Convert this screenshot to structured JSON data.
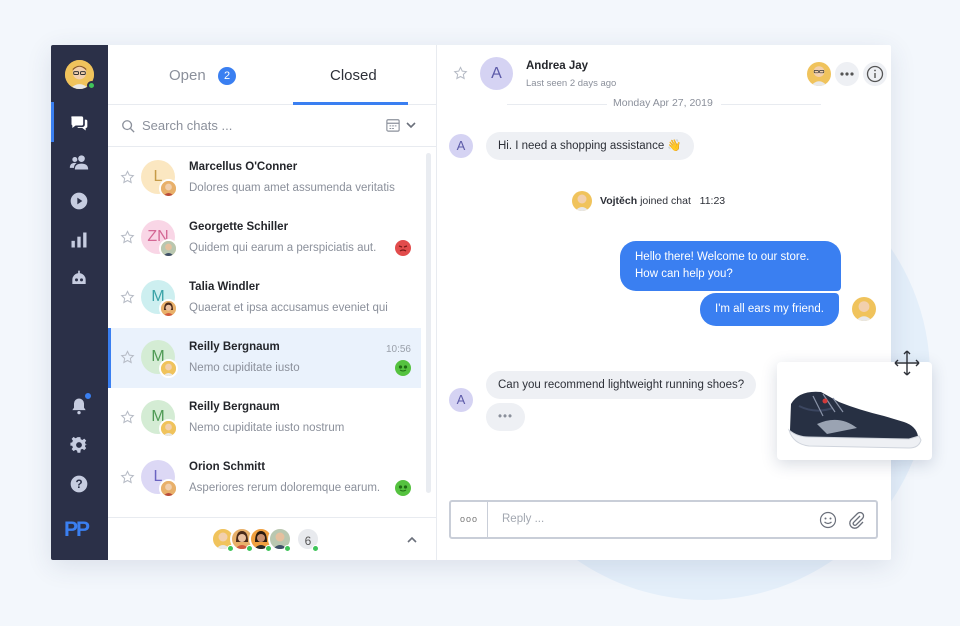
{
  "colors": {
    "accent": "#3a7ff1",
    "rail": "#2b3048",
    "online": "#3fc45a"
  },
  "sidebar": {
    "icons": [
      "chat-icon",
      "contacts-icon",
      "play-icon",
      "stats-icon",
      "bot-icon",
      "bell-icon",
      "gear-icon",
      "help-icon"
    ],
    "logo": "PP"
  },
  "tabs": {
    "open_label": "Open",
    "open_count": "2",
    "closed_label": "Closed"
  },
  "search": {
    "placeholder": "Search chats ..."
  },
  "chats": [
    {
      "name": "Marcellus O'Conner",
      "message": "Dolores quam amet assumenda veritatis",
      "initial": "L",
      "time": "",
      "status": ""
    },
    {
      "name": "Georgette Schiller",
      "message": "Quidem qui earum a perspiciatis aut.",
      "initial": "ZN",
      "time": "",
      "status": "angry"
    },
    {
      "name": "Talia Windler",
      "message": "Quaerat et ipsa accusamus eveniet qui",
      "initial": "M",
      "time": "",
      "status": ""
    },
    {
      "name": "Reilly Bergnaum",
      "message": "Nemo cupiditate iusto",
      "initial": "M",
      "time": "10:56",
      "status": "happy"
    },
    {
      "name": "Reilly Bergnaum",
      "message": "Nemo cupiditate iusto nostrum",
      "initial": "M",
      "time": "",
      "status": ""
    },
    {
      "name": "Orion Schmitt",
      "message": "Asperiores rerum doloremque earum.",
      "initial": "L",
      "time": "",
      "status": "happy"
    }
  ],
  "footer": {
    "more_agents": "6"
  },
  "conversation": {
    "title": "Andrea Jay",
    "subtitle": "Last seen 2 days ago",
    "avatar_initial": "A",
    "date": "Monday Apr 27, 2019",
    "msg1": "Hi. I need a shopping assistance",
    "msg1_emoji": "👋",
    "join_name": "Vojtěch",
    "join_text": "joined chat",
    "join_time": "11:23",
    "out1": "Hello there! Welcome to our store. How can help you?",
    "out2": "I'm all ears my friend.",
    "msg2": "Can you recommend lightweight running shoes?",
    "typing": "•••",
    "reply_placeholder": "Reply ...",
    "reply_dots": "ooo"
  }
}
